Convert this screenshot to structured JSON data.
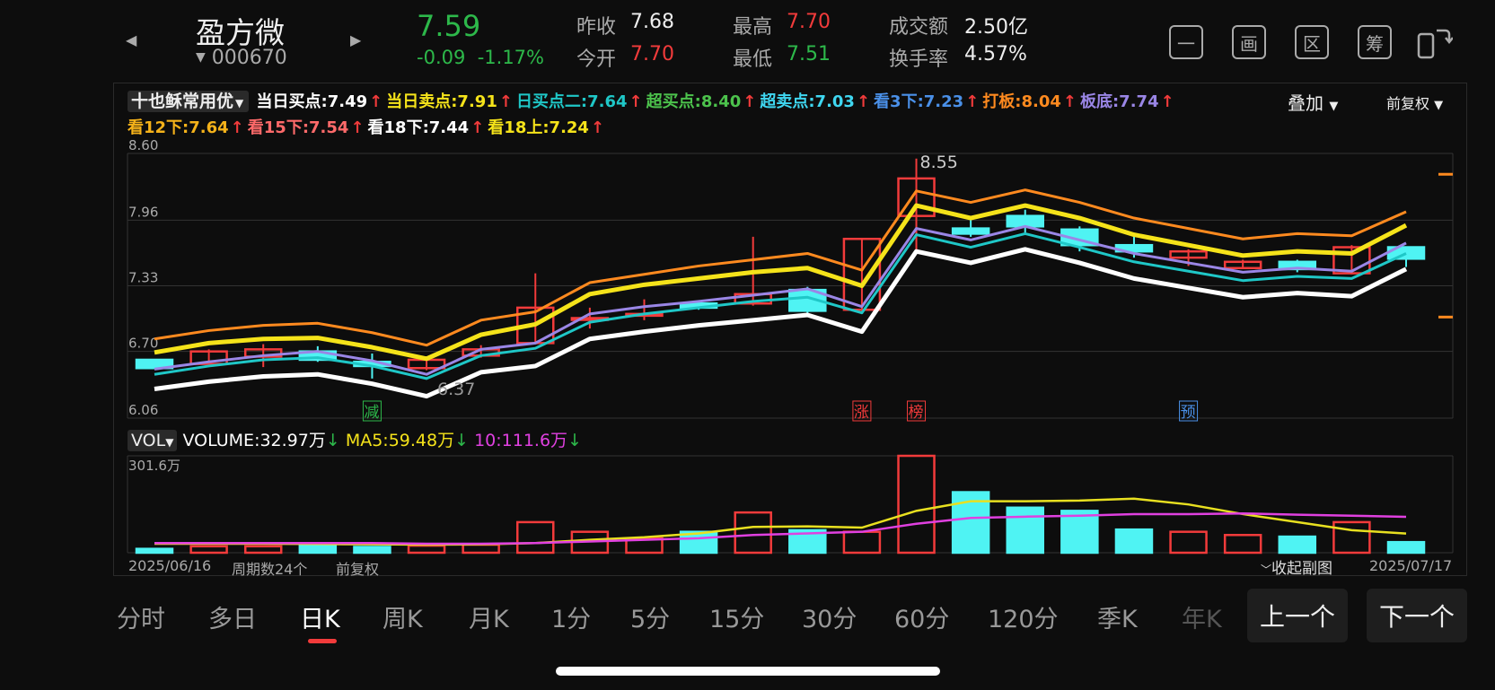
{
  "header": {
    "stock_name": "盈方微",
    "stock_code": "000670",
    "price": "7.59",
    "change_abs": "-0.09",
    "change_pct": "-1.17%",
    "stats": [
      {
        "label": "昨收",
        "value": "7.68",
        "color": "white"
      },
      {
        "label": "今开",
        "value": "7.70",
        "color": "red"
      },
      {
        "label": "最高",
        "value": "7.70",
        "color": "red"
      },
      {
        "label": "最低",
        "value": "7.51",
        "color": "green"
      },
      {
        "label": "成交额",
        "value": "2.50亿",
        "color": "white"
      },
      {
        "label": "换手率",
        "value": "4.57%",
        "color": "white"
      }
    ],
    "tools": [
      "一",
      "画",
      "区",
      "筹"
    ]
  },
  "indicators": {
    "selector": "十也稣常用优",
    "overlay": "叠加",
    "adjust": "前复权",
    "row1": [
      {
        "label": "当日买点:7.49",
        "color": "#ffffff"
      },
      {
        "label": "当日卖点:7.91",
        "color": "#f5e31a"
      },
      {
        "label": "日买点二:7.64",
        "color": "#1fc7c7"
      },
      {
        "label": "超买点:8.40",
        "color": "#4cc24c"
      },
      {
        "label": "超卖点:7.03",
        "color": "#3fd6f0"
      },
      {
        "label": "看3下:7.23",
        "color": "#4a90e8"
      },
      {
        "label": "打板:8.04",
        "color": "#ff8a1f"
      },
      {
        "label": "板底:7.74",
        "color": "#9a86e6"
      }
    ],
    "row2": [
      {
        "label": "看12下:7.64",
        "color": "#f5b21a"
      },
      {
        "label": "看15下:7.54",
        "color": "#ff6a6a"
      },
      {
        "label": "看18下:7.44",
        "color": "#ffffff"
      },
      {
        "label": "看18上:7.24",
        "color": "#f5e31a"
      }
    ],
    "arrow": "↑"
  },
  "chart_data": {
    "type": "candlestick",
    "y_ticks": [
      "8.60",
      "7.96",
      "7.33",
      "6.70",
      "6.06"
    ],
    "ylim": [
      6.06,
      8.6
    ],
    "high_label": "8.55",
    "low_label": "6.37",
    "candles": [
      {
        "o": 6.62,
        "c": 6.54,
        "h": 6.62,
        "l": 6.54
      },
      {
        "o": 6.58,
        "c": 6.7,
        "h": 6.72,
        "l": 6.58
      },
      {
        "o": 6.65,
        "c": 6.72,
        "h": 6.77,
        "l": 6.55
      },
      {
        "o": 6.7,
        "c": 6.62,
        "h": 6.75,
        "l": 6.6
      },
      {
        "o": 6.6,
        "c": 6.56,
        "h": 6.68,
        "l": 6.44
      },
      {
        "o": 6.54,
        "c": 6.62,
        "h": 6.62,
        "l": 6.52
      },
      {
        "o": 6.66,
        "c": 6.72,
        "h": 6.76,
        "l": 6.64
      },
      {
        "o": 6.78,
        "c": 7.12,
        "h": 7.45,
        "l": 6.78
      },
      {
        "o": 7.02,
        "c": 7.02,
        "h": 7.12,
        "l": 6.92
      },
      {
        "o": 7.06,
        "c": 7.06,
        "h": 7.2,
        "l": 7.0
      },
      {
        "o": 7.16,
        "c": 7.12,
        "h": 7.18,
        "l": 7.1
      },
      {
        "o": 7.16,
        "c": 7.25,
        "h": 7.8,
        "l": 7.14
      },
      {
        "o": 7.29,
        "c": 7.09,
        "h": 7.32,
        "l": 7.05
      },
      {
        "o": 7.1,
        "c": 7.78,
        "h": 7.78,
        "l": 7.08
      },
      {
        "o": 8.0,
        "c": 8.36,
        "h": 8.55,
        "l": 7.66
      },
      {
        "o": 7.88,
        "c": 7.83,
        "h": 7.98,
        "l": 7.8
      },
      {
        "o": 8.0,
        "c": 7.9,
        "h": 8.06,
        "l": 7.84
      },
      {
        "o": 7.87,
        "c": 7.72,
        "h": 7.9,
        "l": 7.66
      },
      {
        "o": 7.72,
        "c": 7.66,
        "h": 7.82,
        "l": 7.6
      },
      {
        "o": 7.6,
        "c": 7.66,
        "h": 7.68,
        "l": 7.52
      },
      {
        "o": 7.5,
        "c": 7.56,
        "h": 7.58,
        "l": 7.5
      },
      {
        "o": 7.56,
        "c": 7.49,
        "h": 7.58,
        "l": 7.46
      },
      {
        "o": 7.45,
        "c": 7.7,
        "h": 7.72,
        "l": 7.44
      },
      {
        "o": 7.7,
        "c": 7.59,
        "h": 7.7,
        "l": 7.51
      }
    ],
    "lines": [
      {
        "name": "打板",
        "color": "#ff8a1f",
        "values": [
          6.82,
          6.9,
          6.95,
          6.97,
          6.88,
          6.76,
          7.0,
          7.08,
          7.36,
          7.44,
          7.52,
          7.58,
          7.64,
          7.48,
          8.24,
          8.13,
          8.25,
          8.13,
          7.98,
          7.88,
          7.78,
          7.83,
          7.81,
          8.04
        ]
      },
      {
        "name": "当日卖点",
        "color": "#f5e31a",
        "values": [
          6.69,
          6.78,
          6.82,
          6.83,
          6.74,
          6.63,
          6.86,
          6.96,
          7.25,
          7.34,
          7.4,
          7.46,
          7.5,
          7.33,
          8.1,
          7.98,
          8.1,
          7.98,
          7.82,
          7.72,
          7.62,
          7.66,
          7.64,
          7.91
        ]
      },
      {
        "name": "板底",
        "color": "#9a86e6",
        "values": [
          6.53,
          6.6,
          6.66,
          6.7,
          6.61,
          6.48,
          6.72,
          6.78,
          7.06,
          7.13,
          7.18,
          7.24,
          7.3,
          7.13,
          7.88,
          7.77,
          7.9,
          7.77,
          7.64,
          7.55,
          7.46,
          7.5,
          7.47,
          7.74
        ]
      },
      {
        "name": "日买点二",
        "color": "#1fc7c7",
        "values": [
          6.48,
          6.56,
          6.62,
          6.64,
          6.56,
          6.44,
          6.66,
          6.73,
          6.98,
          7.06,
          7.12,
          7.18,
          7.22,
          7.07,
          7.82,
          7.7,
          7.83,
          7.7,
          7.56,
          7.47,
          7.38,
          7.42,
          7.4,
          7.64
        ]
      },
      {
        "name": "当日买点",
        "color": "#ffffff",
        "values": [
          6.34,
          6.41,
          6.46,
          6.48,
          6.39,
          6.27,
          6.5,
          6.56,
          6.82,
          6.89,
          6.95,
          7.0,
          7.05,
          6.89,
          7.66,
          7.55,
          7.68,
          7.55,
          7.4,
          7.31,
          7.22,
          7.26,
          7.23,
          7.49
        ]
      }
    ],
    "signals": [
      {
        "text": "减",
        "index": 4,
        "color": "#2db84a"
      },
      {
        "text": "涨",
        "index": 13,
        "color": "#f23b3b"
      },
      {
        "text": "榜",
        "index": 14,
        "color": "#f23b3b"
      },
      {
        "text": "预",
        "index": 19,
        "color": "#4a90e8"
      }
    ],
    "volume": {
      "header_label": "VOL",
      "volume_text": "VOLUME:32.97万",
      "ma5_text": "MA5:59.48万",
      "ma10_text": "10:111.6万",
      "max_label": "301.6万",
      "values": [
        12,
        20,
        20,
        22,
        18,
        22,
        25,
        95,
        65,
        45,
        65,
        125,
        70,
        65,
        301,
        188,
        140,
        130,
        72,
        65,
        55,
        50,
        95,
        32.97
      ],
      "ma5": [
        28,
        28,
        28,
        27,
        26,
        25,
        26,
        30,
        40,
        48,
        60,
        80,
        82,
        78,
        130,
        160,
        160,
        162,
        168,
        150,
        120,
        95,
        70,
        59.48
      ],
      "ma10": [
        30,
        30,
        30,
        30,
        30,
        28,
        28,
        30,
        35,
        40,
        45,
        55,
        60,
        65,
        90,
        108,
        112,
        115,
        120,
        120,
        122,
        118,
        115,
        111.6
      ]
    },
    "date_start": "2025/06/16",
    "period_count": "周期数24个",
    "adjust_label": "前复权",
    "collapse_label": "收起副图",
    "date_end": "2025/07/17"
  },
  "tabs": [
    "分时",
    "多日",
    "日K",
    "周K",
    "月K",
    "1分",
    "5分",
    "15分",
    "30分",
    "60分",
    "120分",
    "季K",
    "年K"
  ],
  "active_tab": "日K",
  "nav": {
    "prev": "上一个",
    "next": "下一个"
  }
}
